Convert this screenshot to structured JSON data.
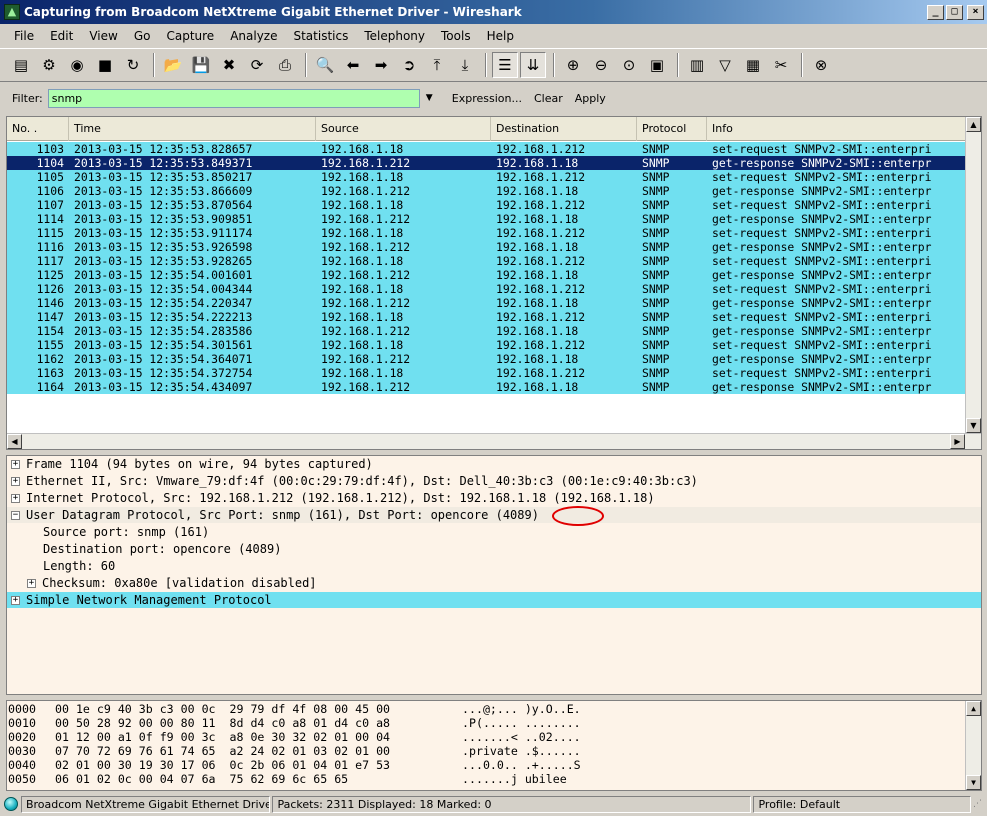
{
  "window": {
    "title": "Capturing from Broadcom NetXtreme Gigabit Ethernet Driver - Wireshark",
    "minimize": "_",
    "maximize": "□",
    "close": "×"
  },
  "menu": [
    "File",
    "Edit",
    "View",
    "Go",
    "Capture",
    "Analyze",
    "Statistics",
    "Telephony",
    "Tools",
    "Help"
  ],
  "toolbar": {
    "buttons": [
      {
        "name": "interfaces-icon",
        "glyph": "▤"
      },
      {
        "name": "capture-options-icon",
        "glyph": "⚙"
      },
      {
        "name": "start-capture-icon",
        "glyph": "◉"
      },
      {
        "name": "stop-capture-icon",
        "glyph": "■"
      },
      {
        "name": "restart-capture-icon",
        "glyph": "↻"
      },
      {
        "name": "sep"
      },
      {
        "name": "open-file-icon",
        "glyph": "📂"
      },
      {
        "name": "save-file-icon",
        "glyph": "💾"
      },
      {
        "name": "close-file-icon",
        "glyph": "✖"
      },
      {
        "name": "reload-icon",
        "glyph": "⟳"
      },
      {
        "name": "print-icon",
        "glyph": "⎙"
      },
      {
        "name": "sep"
      },
      {
        "name": "find-packet-icon",
        "glyph": "🔍"
      },
      {
        "name": "go-back-icon",
        "glyph": "⬅"
      },
      {
        "name": "go-forward-icon",
        "glyph": "➡"
      },
      {
        "name": "go-to-packet-icon",
        "glyph": "➲"
      },
      {
        "name": "go-first-icon",
        "glyph": "⤒"
      },
      {
        "name": "go-last-icon",
        "glyph": "⤓"
      },
      {
        "name": "sep"
      },
      {
        "name": "colorize-icon",
        "glyph": "☰",
        "pressed": true
      },
      {
        "name": "auto-scroll-icon",
        "glyph": "⇊",
        "pressed": true
      },
      {
        "name": "sep"
      },
      {
        "name": "zoom-in-icon",
        "glyph": "⊕"
      },
      {
        "name": "zoom-out-icon",
        "glyph": "⊖"
      },
      {
        "name": "normal-size-icon",
        "glyph": "⊙"
      },
      {
        "name": "resize-columns-icon",
        "glyph": "▣"
      },
      {
        "name": "sep"
      },
      {
        "name": "capture-filters-icon",
        "glyph": "▥"
      },
      {
        "name": "display-filters-icon",
        "glyph": "▽"
      },
      {
        "name": "coloring-rules-icon",
        "glyph": "▦"
      },
      {
        "name": "preferences-icon",
        "glyph": "✂"
      },
      {
        "name": "sep"
      },
      {
        "name": "help-icon",
        "glyph": "⊗"
      }
    ]
  },
  "filter": {
    "label": "Filter:",
    "value": "snmp",
    "expression": "Expression...",
    "clear": "Clear",
    "apply": "Apply"
  },
  "packet_list": {
    "columns": [
      "No. .",
      "Time",
      "Source",
      "Destination",
      "Protocol",
      "Info"
    ],
    "selected_index": 1,
    "rows": [
      [
        "1103",
        "2013-03-15 12:35:53.828657",
        "192.168.1.18",
        "192.168.1.212",
        "SNMP",
        "set-request SNMPv2-SMI::enterpri"
      ],
      [
        "1104",
        "2013-03-15 12:35:53.849371",
        "192.168.1.212",
        "192.168.1.18",
        "SNMP",
        "get-response SNMPv2-SMI::enterpr"
      ],
      [
        "1105",
        "2013-03-15 12:35:53.850217",
        "192.168.1.18",
        "192.168.1.212",
        "SNMP",
        "set-request SNMPv2-SMI::enterpri"
      ],
      [
        "1106",
        "2013-03-15 12:35:53.866609",
        "192.168.1.212",
        "192.168.1.18",
        "SNMP",
        "get-response SNMPv2-SMI::enterpr"
      ],
      [
        "1107",
        "2013-03-15 12:35:53.870564",
        "192.168.1.18",
        "192.168.1.212",
        "SNMP",
        "set-request SNMPv2-SMI::enterpri"
      ],
      [
        "1114",
        "2013-03-15 12:35:53.909851",
        "192.168.1.212",
        "192.168.1.18",
        "SNMP",
        "get-response SNMPv2-SMI::enterpr"
      ],
      [
        "1115",
        "2013-03-15 12:35:53.911174",
        "192.168.1.18",
        "192.168.1.212",
        "SNMP",
        "set-request SNMPv2-SMI::enterpri"
      ],
      [
        "1116",
        "2013-03-15 12:35:53.926598",
        "192.168.1.212",
        "192.168.1.18",
        "SNMP",
        "get-response SNMPv2-SMI::enterpr"
      ],
      [
        "1117",
        "2013-03-15 12:35:53.928265",
        "192.168.1.18",
        "192.168.1.212",
        "SNMP",
        "set-request SNMPv2-SMI::enterpri"
      ],
      [
        "1125",
        "2013-03-15 12:35:54.001601",
        "192.168.1.212",
        "192.168.1.18",
        "SNMP",
        "get-response SNMPv2-SMI::enterpr"
      ],
      [
        "1126",
        "2013-03-15 12:35:54.004344",
        "192.168.1.18",
        "192.168.1.212",
        "SNMP",
        "set-request SNMPv2-SMI::enterpri"
      ],
      [
        "1146",
        "2013-03-15 12:35:54.220347",
        "192.168.1.212",
        "192.168.1.18",
        "SNMP",
        "get-response SNMPv2-SMI::enterpr"
      ],
      [
        "1147",
        "2013-03-15 12:35:54.222213",
        "192.168.1.18",
        "192.168.1.212",
        "SNMP",
        "set-request SNMPv2-SMI::enterpri"
      ],
      [
        "1154",
        "2013-03-15 12:35:54.283586",
        "192.168.1.212",
        "192.168.1.18",
        "SNMP",
        "get-response SNMPv2-SMI::enterpr"
      ],
      [
        "1155",
        "2013-03-15 12:35:54.301561",
        "192.168.1.18",
        "192.168.1.212",
        "SNMP",
        "set-request SNMPv2-SMI::enterpri"
      ],
      [
        "1162",
        "2013-03-15 12:35:54.364071",
        "192.168.1.212",
        "192.168.1.18",
        "SNMP",
        "get-response SNMPv2-SMI::enterpr"
      ],
      [
        "1163",
        "2013-03-15 12:35:54.372754",
        "192.168.1.18",
        "192.168.1.212",
        "SNMP",
        "set-request SNMPv2-SMI::enterpri"
      ],
      [
        "1164",
        "2013-03-15 12:35:54.434097",
        "192.168.1.212",
        "192.168.1.18",
        "SNMP",
        "get-response SNMPv2-SMI::enterpr"
      ]
    ]
  },
  "details": [
    {
      "text": "Frame 1104 (94 bytes on wire, 94 bytes captured)",
      "level": 0,
      "expander": "+"
    },
    {
      "text": "Ethernet II, Src: Vmware_79:df:4f (00:0c:29:79:df:4f), Dst: Dell_40:3b:c3 (00:1e:c9:40:3b:c3)",
      "level": 0,
      "expander": "+"
    },
    {
      "text": "Internet Protocol, Src: 192.168.1.212 (192.168.1.212), Dst: 192.168.1.18 (192.168.1.18)",
      "level": 0,
      "expander": "+"
    },
    {
      "text": "User Datagram Protocol, Src Port: snmp (161), Dst Port: opencore (4089)",
      "level": 0,
      "expander": "−",
      "shaded": true
    },
    {
      "text": "Source port: snmp (161)",
      "level": 1,
      "expander": ""
    },
    {
      "text": "Destination port: opencore (4089)",
      "level": 1,
      "expander": ""
    },
    {
      "text": "Length: 60",
      "level": 1,
      "expander": ""
    },
    {
      "text": "Checksum: 0xa80e [validation disabled]",
      "level": 1,
      "expander": "+"
    },
    {
      "text": "Simple Network Management Protocol",
      "level": 0,
      "expander": "+",
      "highlight": true
    }
  ],
  "bytes": [
    {
      "offset": "0000",
      "hex": "00 1e c9 40 3b c3 00 0c  29 79 df 4f 08 00 45 00",
      "ascii": "...@;... )y.O..E."
    },
    {
      "offset": "0010",
      "hex": "00 50 28 92 00 00 80 11  8d d4 c0 a8 01 d4 c0 a8",
      "ascii": ".P(..... ........"
    },
    {
      "offset": "0020",
      "hex": "01 12 00 a1 0f f9 00 3c  a8 0e 30 32 02 01 00 04",
      "ascii": ".......< ..02...."
    },
    {
      "offset": "0030",
      "hex": "07 70 72 69 76 61 74 65  a2 24 02 01 03 02 01 00",
      "ascii": ".private .$......"
    },
    {
      "offset": "0040",
      "hex": "02 01 00 30 19 30 17 06  0c 2b 06 01 04 01 e7 53",
      "ascii": "...0.0.. .+.....S"
    },
    {
      "offset": "0050",
      "hex": "06 01 02 0c 00 04 07 6a  75 62 69 6c 65 65",
      "ascii": ".......j ubilee"
    }
  ],
  "status": {
    "interface": "Broadcom NetXtreme Gigabit Ethernet Driver: <li...",
    "packets": "Packets: 2311 Displayed: 18 Marked: 0",
    "profile": "Profile: Default"
  },
  "colors": {
    "snmp_row": "#70e0f0",
    "selected_row": "#0a246a",
    "filter_valid": "#afffaf",
    "annotation": "#e00000"
  }
}
